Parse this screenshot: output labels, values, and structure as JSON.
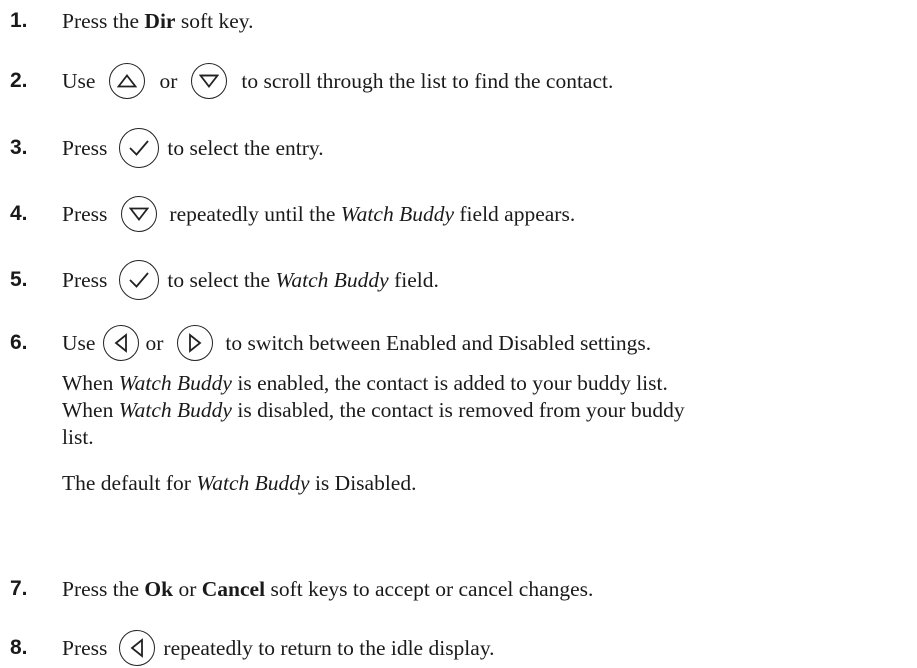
{
  "steps": [
    {
      "num": "1.",
      "a": "Press the ",
      "b": "Dir",
      "c": " soft key."
    },
    {
      "num": "2.",
      "a": "Use",
      "b": "or",
      "c": "to scroll through the list to find the contact."
    },
    {
      "num": "3.",
      "a": "Press",
      "b": "to select the entry."
    },
    {
      "num": "4.",
      "a": "Press",
      "b": "repeatedly until the ",
      "c": "Watch Buddy",
      "d": " field appears."
    },
    {
      "num": "5.",
      "a": "Press",
      "b": "to select the ",
      "c": "Watch Buddy",
      "d": " field."
    },
    {
      "num": "6.",
      "a": "Use",
      "b": "or",
      "c": "to switch between Enabled and Disabled settings."
    },
    {
      "num": "7.",
      "a": "Press the ",
      "b": "Ok",
      "c": " or ",
      "d": "Cancel",
      "e": " soft keys to accept or cancel changes."
    },
    {
      "num": "8.",
      "a": "Press",
      "b": "repeatedly to return to the idle display."
    }
  ],
  "note1": {
    "l1a": "When ",
    "l1b": "Watch Buddy",
    "l1c": " is enabled, the contact is added to your buddy list.",
    "l2a": "When ",
    "l2b": "Watch Buddy",
    "l2c": " is disabled, the contact is removed from your buddy",
    "l3": "list."
  },
  "note2": {
    "a": "The default for ",
    "b": "Watch Buddy",
    "c": " is Disabled."
  },
  "icons": {
    "up": "up-arrow-key-icon",
    "down": "down-arrow-key-icon",
    "select": "checkmark-select-key-icon",
    "left": "left-arrow-key-icon",
    "right": "right-arrow-key-icon"
  }
}
